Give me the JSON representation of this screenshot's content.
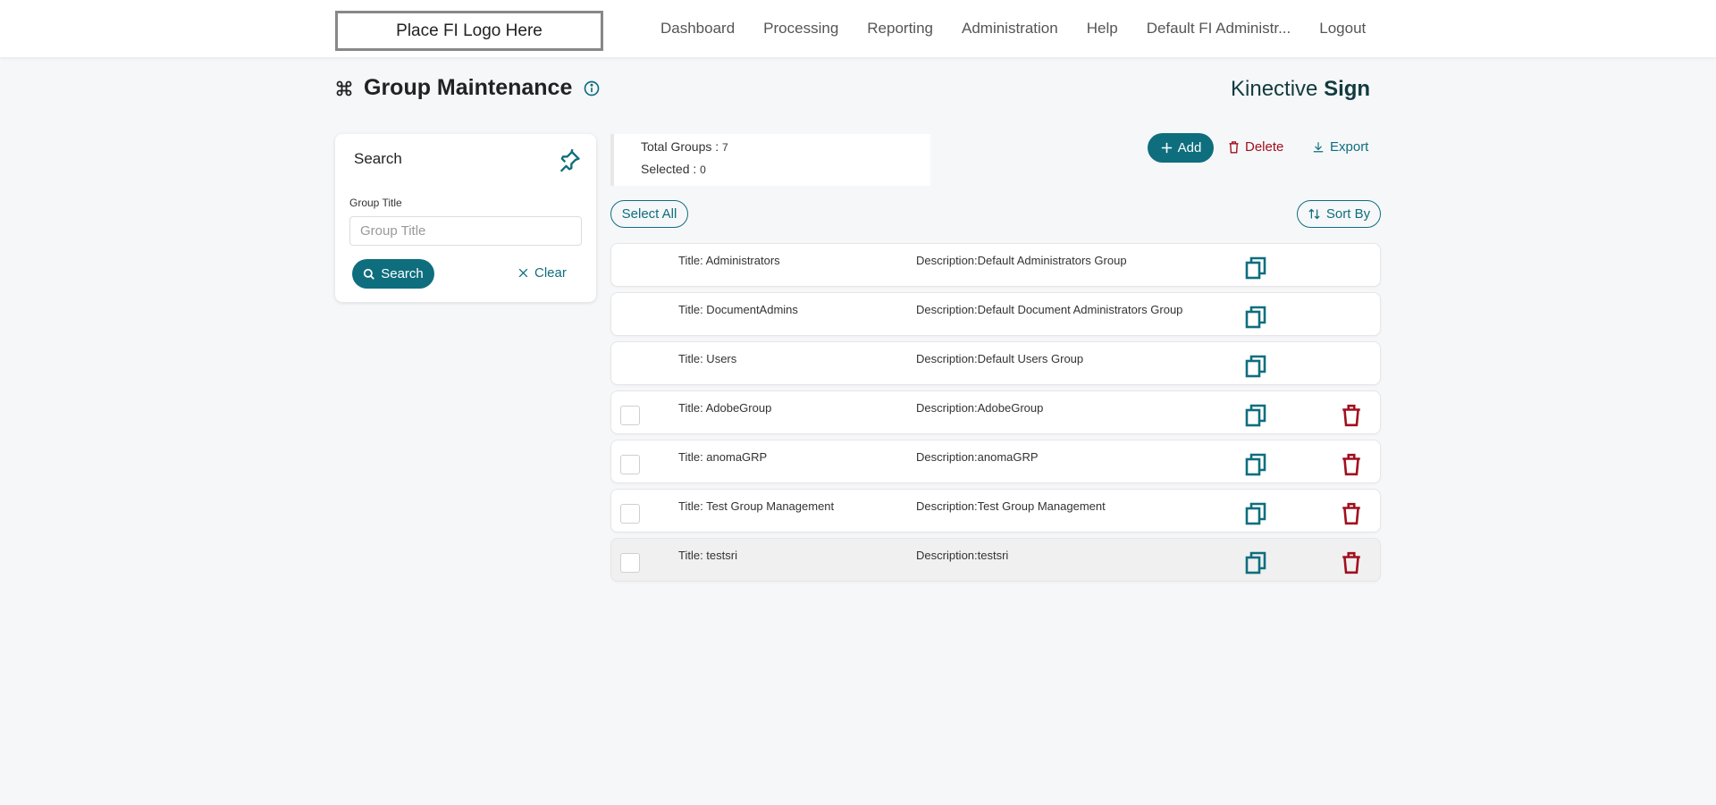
{
  "header": {
    "logo_text": "Place FI Logo Here",
    "nav": [
      "Dashboard",
      "Processing",
      "Reporting",
      "Administration",
      "Help",
      "Default FI Administr...",
      "Logout"
    ]
  },
  "page": {
    "title": "Group Maintenance",
    "brand_light": "Kinective ",
    "brand_bold": "Sign"
  },
  "search": {
    "heading": "Search",
    "field_label": "Group Title",
    "field_value": "",
    "field_placeholder": "Group Title",
    "search_label": "Search",
    "clear_label": "Clear"
  },
  "summary": {
    "total_label": "Total Groups : ",
    "total_value": "7",
    "selected_label": "Selected : ",
    "selected_value": "0"
  },
  "actions": {
    "add_label": "Add",
    "delete_label": "Delete",
    "export_label": "Export",
    "select_all_label": "Select All",
    "sort_label": "Sort By"
  },
  "groups": [
    {
      "title": "Title: Administrators",
      "description": "Description:Default Administrators Group"
    },
    {
      "title": "Title: DocumentAdmins",
      "description": "Description:Default Document Administrators Group"
    },
    {
      "title": "Title: Users",
      "description": "Description:Default Users Group"
    },
    {
      "title": "Title: AdobeGroup",
      "description": "Description:AdobeGroup"
    },
    {
      "title": "Title: anomaGRP",
      "description": "Description:anomaGRP"
    },
    {
      "title": "Title: Test Group Management",
      "description": "Description:Test Group Management"
    },
    {
      "title": "Title: testsri",
      "description": "Description:testsri"
    }
  ],
  "colors": {
    "accent": "#0e6e7e",
    "danger": "#a0101e",
    "background": "#f6f7f9"
  }
}
